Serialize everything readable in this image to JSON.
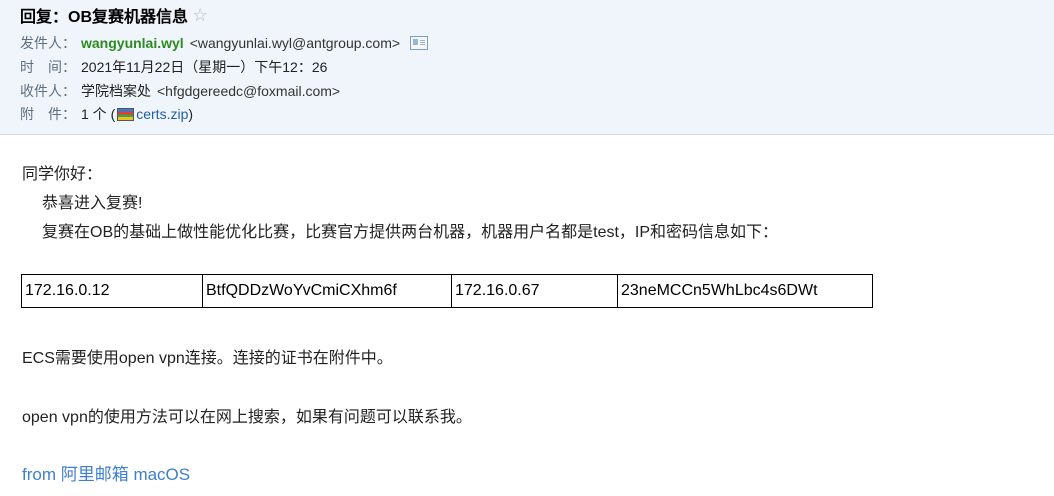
{
  "email": {
    "subject": "回复：OB复赛机器信息",
    "from_label": "发件人：",
    "from_name": "wangyunlai.wyl",
    "from_addr": "<wangyunlai.wyl@antgroup.com>",
    "time_label": "时　间：",
    "time_value": "2021年11月22日（星期一）下午12：26",
    "to_label": "收件人：",
    "to_name": "学院档案处",
    "to_addr": "<hfgdgereedc@foxmail.com>",
    "attach_label": "附　件：",
    "attach_count": "1 个 (",
    "attach_file": "certs.zip",
    "attach_close": ")"
  },
  "body": {
    "greeting": "同学你好：",
    "line1": "恭喜进入复赛!",
    "line2": "复赛在OB的基础上做性能优化比赛，比赛官方提供两台机器，机器用户名都是test，IP和密码信息如下：",
    "table": [
      [
        "172.16.0.12",
        "BtfQDDzWoYvCmiCXhm6f",
        "172.16.0.67",
        "23neMCCn5WhLbc4s6DWt"
      ]
    ],
    "para1": "ECS需要使用open vpn连接。连接的证书在附件中。",
    "para2": "open vpn的使用方法可以在网上搜索，如果有问题可以联系我。",
    "signature": "from 阿里邮箱 macOS"
  },
  "icons": {
    "star": "star-outline-icon",
    "card": "contact-card-icon",
    "zip": "zip-file-icon"
  }
}
